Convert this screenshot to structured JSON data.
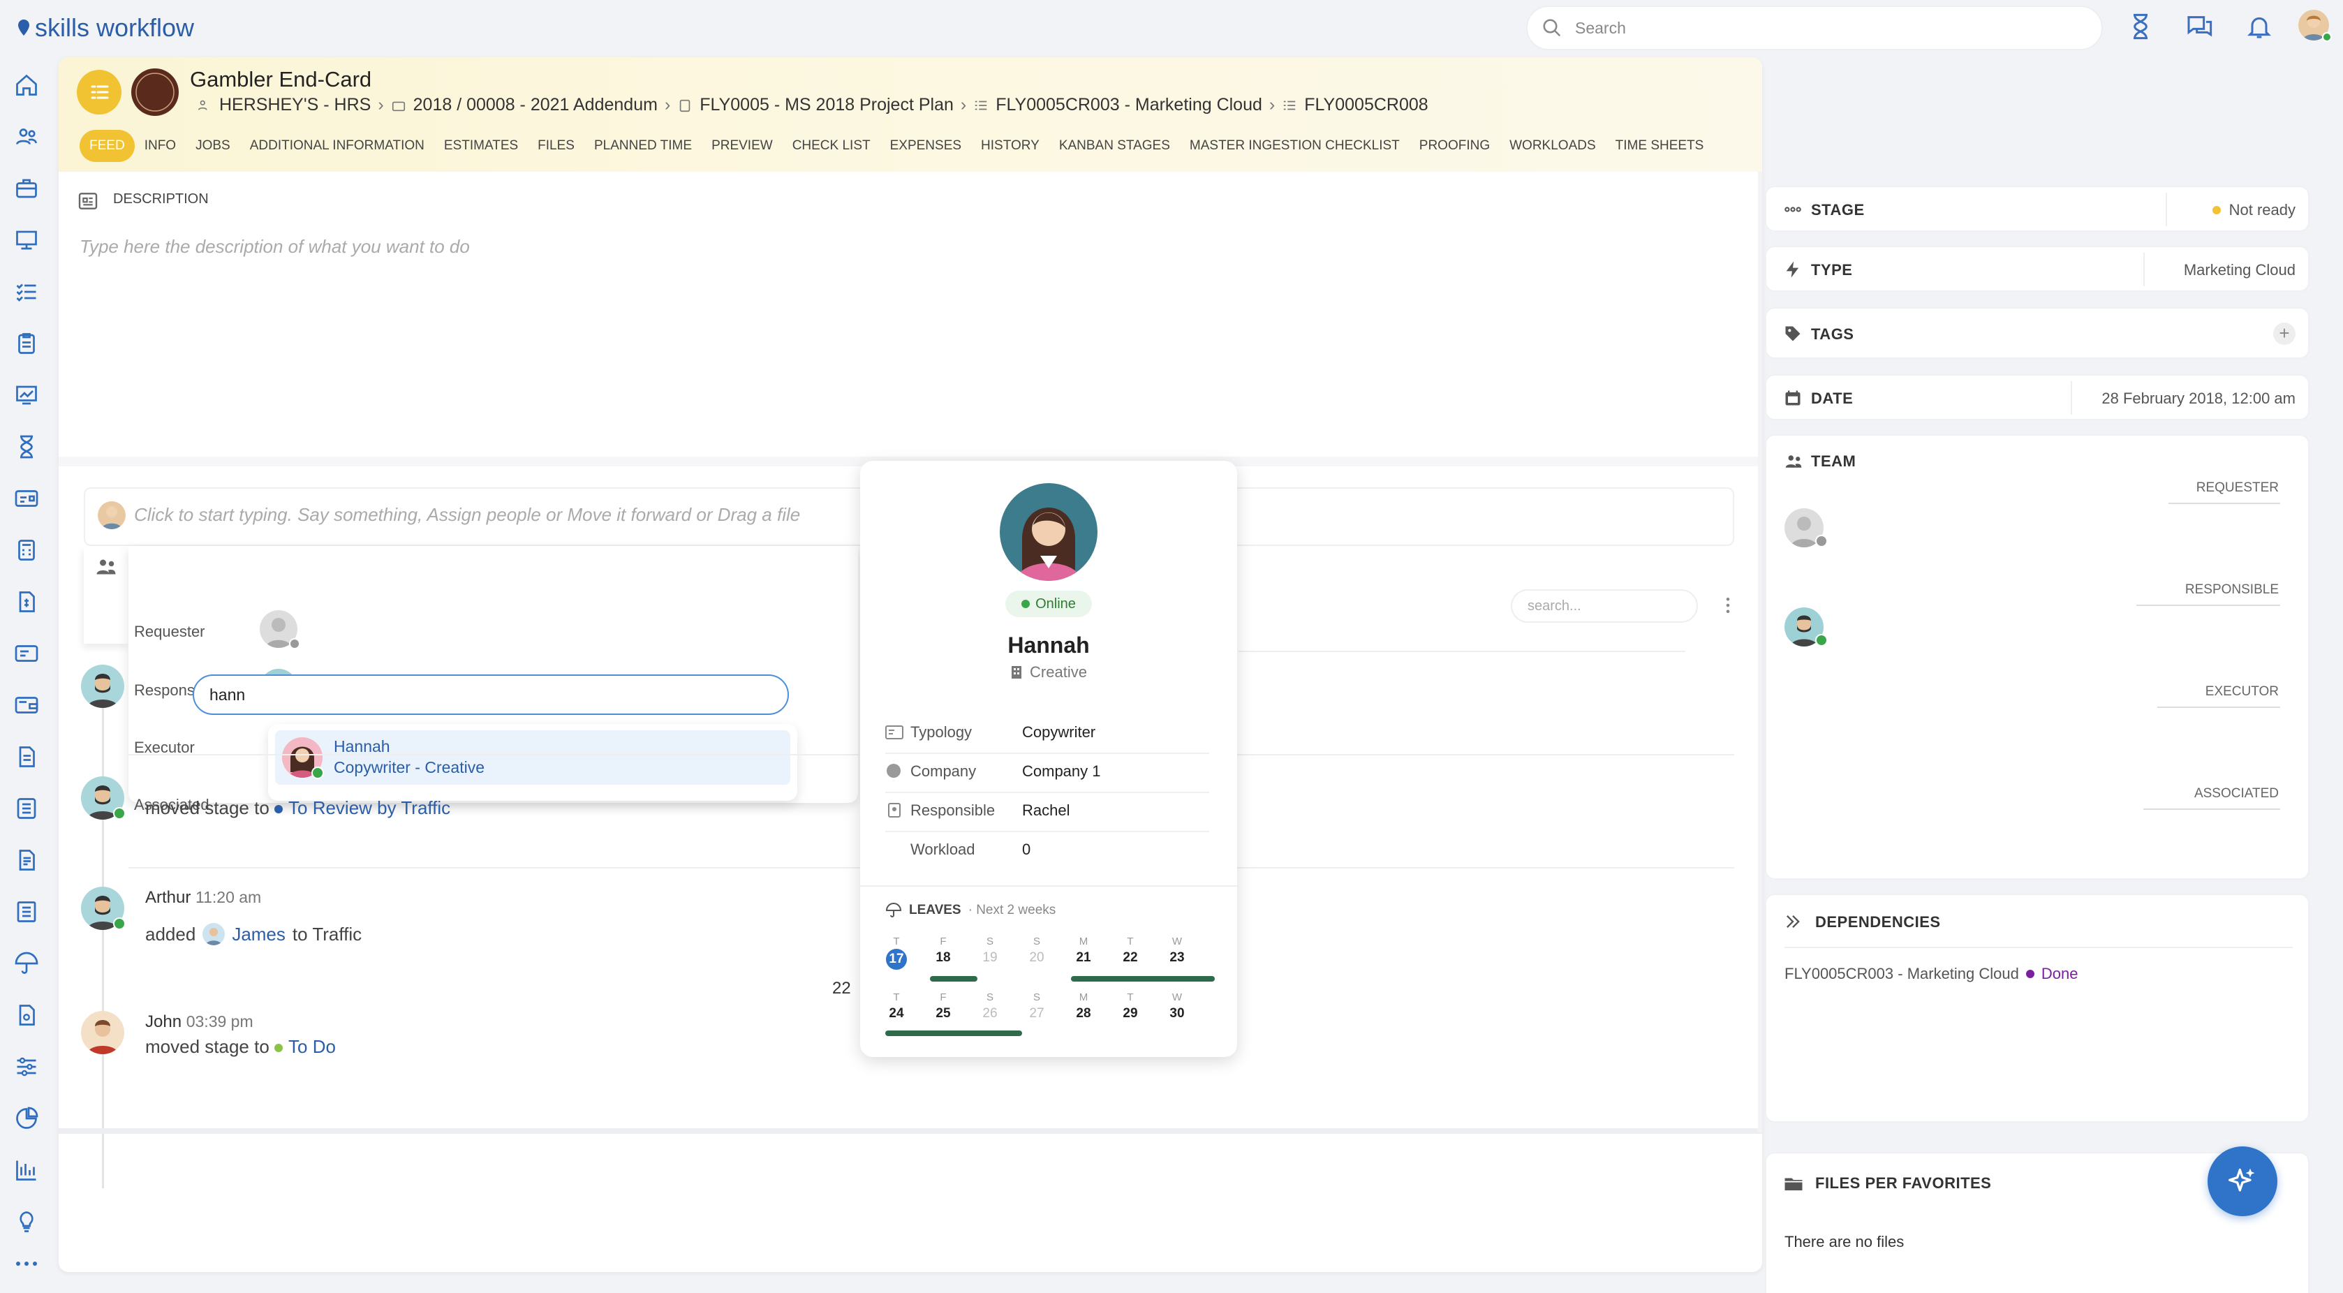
{
  "app": {
    "name": "skills workflow"
  },
  "search": {
    "placeholder": "Search"
  },
  "header": {
    "title": "Gambler End-Card",
    "brand_logo_text": "HERSHEY'S",
    "breadcrumbs": [
      "HERSHEY'S - HRS",
      "2018 / 00008 - 2021 Addendum",
      "FLY0005 - MS 2018 Project Plan",
      "FLY0005CR003 - Marketing Cloud",
      "FLY0005CR008"
    ],
    "tabs": [
      "FEED",
      "INFO",
      "JOBS",
      "ADDITIONAL INFORMATION",
      "ESTIMATES",
      "FILES",
      "PLANNED TIME",
      "PREVIEW",
      "CHECK LIST",
      "EXPENSES",
      "HISTORY",
      "KANBAN STAGES",
      "MASTER INGESTION CHECKLIST",
      "PROOFING",
      "WORKLOADS",
      "TIME SHEETS"
    ],
    "active_tab": "FEED"
  },
  "description": {
    "label": "DESCRIPTION",
    "placeholder": "Type here the description of what you want to do"
  },
  "composer": {
    "placeholder": "Click to start typing. Say something, Assign people or Move it forward or Drag a file",
    "roles": {
      "requester": "Requester",
      "responsible": "Responsible",
      "executor": "Executor",
      "associated": "Associated"
    },
    "executor_value": "hann",
    "suggestion": {
      "name": "Hannah",
      "subtitle": "Copywriter - Creative"
    }
  },
  "feed": {
    "search_placeholder": "search...",
    "entries": [
      {
        "text": "moved stage to",
        "target": "To Review by Traffic",
        "dot_color": "#2a5ea8"
      },
      {
        "name": "Arthur",
        "time": "11:20 am",
        "text_before": "added",
        "person": "James",
        "text_after": "to Traffic"
      },
      {
        "date_marker": "22"
      },
      {
        "name": "John",
        "time": "03:39 pm",
        "text": "moved stage to",
        "target": "To Do",
        "dot_color": "#8bc34a"
      }
    ]
  },
  "profile": {
    "status": "Online",
    "name": "Hannah",
    "department": "Creative",
    "rows": [
      {
        "label": "Typology",
        "value": "Copywriter"
      },
      {
        "label": "Company",
        "value": "Company 1"
      },
      {
        "label": "Responsible",
        "value": "Rachel"
      },
      {
        "label": "Workload",
        "value": "0"
      }
    ],
    "leaves": {
      "title": "LEAVES",
      "subtitle": "· Next 2 weeks",
      "week1": [
        {
          "l": "T",
          "n": "17",
          "today": true
        },
        {
          "l": "F",
          "n": "18"
        },
        {
          "l": "S",
          "n": "19",
          "muted": true
        },
        {
          "l": "S",
          "n": "20",
          "muted": true
        },
        {
          "l": "M",
          "n": "21"
        },
        {
          "l": "T",
          "n": "22"
        },
        {
          "l": "W",
          "n": "23"
        }
      ],
      "week2": [
        {
          "l": "T",
          "n": "24"
        },
        {
          "l": "F",
          "n": "25"
        },
        {
          "l": "S",
          "n": "26",
          "muted": true
        },
        {
          "l": "S",
          "n": "27",
          "muted": true
        },
        {
          "l": "M",
          "n": "28"
        },
        {
          "l": "T",
          "n": "29"
        },
        {
          "l": "W",
          "n": "30"
        }
      ]
    }
  },
  "right": {
    "stage": {
      "label": "STAGE",
      "value": "Not ready",
      "dot": "#f1c232"
    },
    "type": {
      "label": "TYPE",
      "value": "Marketing Cloud"
    },
    "tags": {
      "label": "TAGS"
    },
    "date": {
      "label": "DATE",
      "value": "28 February 2018, 12:00 am"
    },
    "team": {
      "label": "TEAM",
      "requester": "REQUESTER",
      "responsible": "RESPONSIBLE",
      "executor": "EXECUTOR",
      "associated": "ASSOCIATED"
    },
    "dependencies": {
      "label": "DEPENDENCIES",
      "item": "FLY0005CR003 - Marketing Cloud",
      "status": "Done",
      "status_color": "#7b1fa2"
    },
    "files": {
      "label": "FILES PER FAVORITES",
      "empty": "There are no files"
    }
  },
  "colors": {
    "accent": "#f1c232",
    "primary": "#2f74c8",
    "online": "#3aa64a",
    "leave_bar": "#2f6b4a"
  }
}
